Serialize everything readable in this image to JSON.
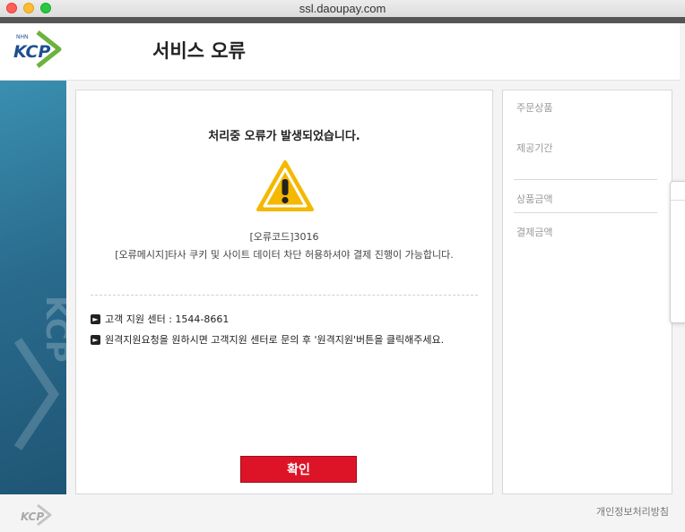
{
  "browser": {
    "url": "ssl.daoupay.com"
  },
  "header": {
    "logo_text": "KCP",
    "logo_small": "NHN",
    "title": "서비스 오류"
  },
  "main": {
    "error_title": "처리중 오류가 발생되었습니다.",
    "error_code": "[오류코드]3016",
    "error_message": "[오류메시지]타사 쿠키 및 사이트 데이터 차단 허용하셔야 결제 진행이 가능합니다.",
    "info_items": [
      "고객 지원 센터 : 1544-8661",
      "원격지원요청을 원하시면 고객지원 센터로 문의 후 '원격지원'버튼을 클릭해주세요."
    ],
    "confirm_label": "확인"
  },
  "summary": {
    "product_label": "주문상품",
    "period_label": "제공기간",
    "price_label": "상품금액",
    "payment_label": "결제금액"
  },
  "footer": {
    "privacy_label": "개인정보처리방침",
    "logo_text": "KCP"
  },
  "colors": {
    "accent": "#dd1428",
    "warning": "#f5b800",
    "band": "#2a6c8e"
  }
}
